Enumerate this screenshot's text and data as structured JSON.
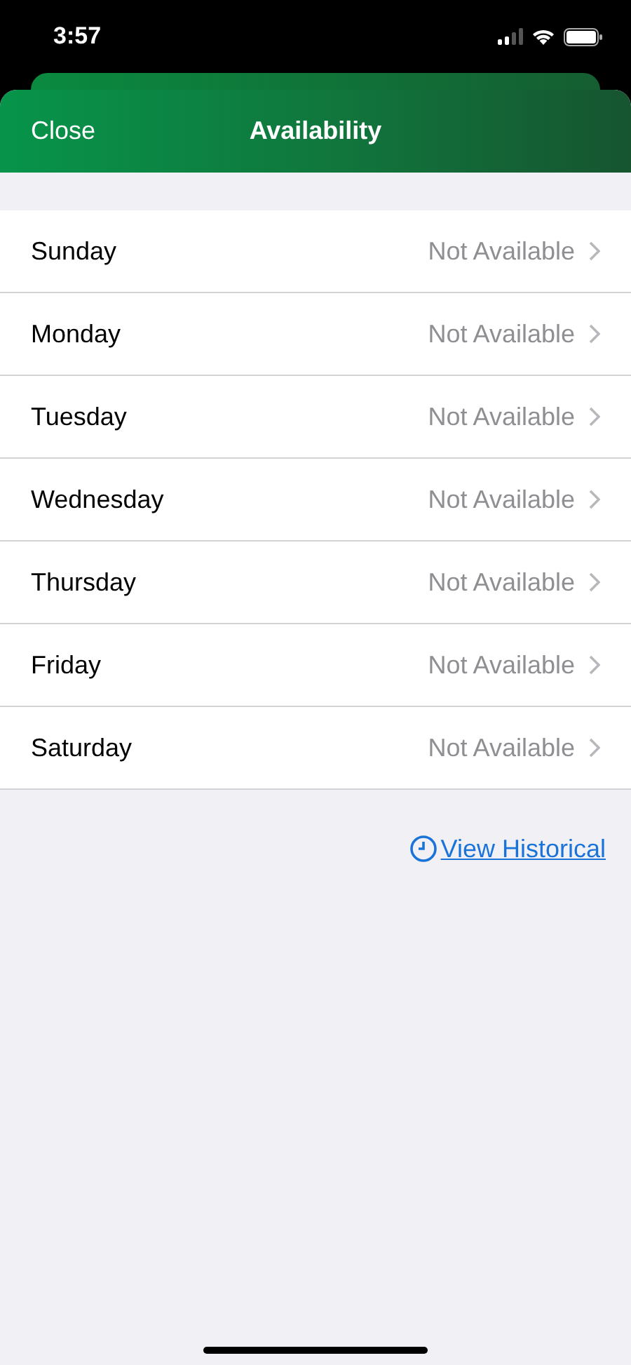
{
  "status_bar": {
    "time": "3:57"
  },
  "header": {
    "close": "Close",
    "title": "Availability"
  },
  "days": [
    {
      "day": "Sunday",
      "status": "Not Available"
    },
    {
      "day": "Monday",
      "status": "Not Available"
    },
    {
      "day": "Tuesday",
      "status": "Not Available"
    },
    {
      "day": "Wednesday",
      "status": "Not Available"
    },
    {
      "day": "Thursday",
      "status": "Not Available"
    },
    {
      "day": "Friday",
      "status": "Not Available"
    },
    {
      "day": "Saturday",
      "status": "Not Available"
    }
  ],
  "link": "View Historical"
}
